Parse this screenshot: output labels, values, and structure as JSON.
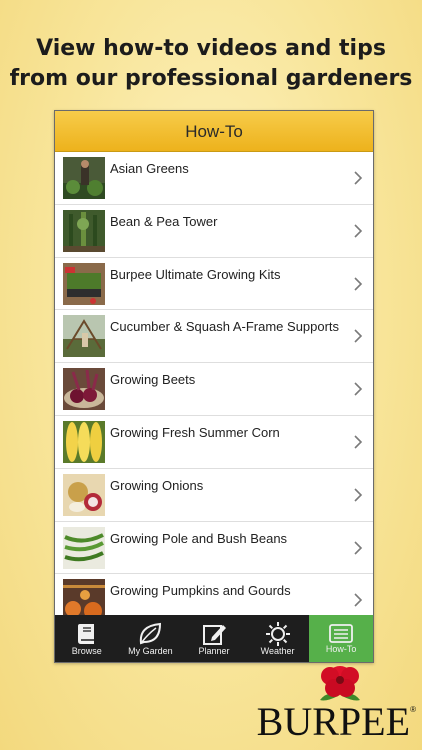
{
  "headline": {
    "line1": "View how-to videos and tips",
    "line2": "from our professional gardeners"
  },
  "navbar": {
    "title": "How-To"
  },
  "items": [
    {
      "label": "Asian Greens",
      "icon": "greens-photo"
    },
    {
      "label": "Bean & Pea Tower",
      "icon": "bean-tower-photo"
    },
    {
      "label": "Burpee Ultimate Growing Kits",
      "icon": "growing-kit-photo"
    },
    {
      "label": "Cucumber & Squash A-Frame Supports",
      "icon": "aframe-photo"
    },
    {
      "label": "Growing Beets",
      "icon": "beets-photo"
    },
    {
      "label": "Growing Fresh Summer Corn",
      "icon": "corn-photo"
    },
    {
      "label": "Growing Onions",
      "icon": "onions-photo"
    },
    {
      "label": "Growing Pole and Bush Beans",
      "icon": "beans-photo"
    },
    {
      "label": "Growing Pumpkins and Gourds",
      "icon": "pumpkins-photo"
    }
  ],
  "tabs": [
    {
      "label": "Browse",
      "icon": "book-icon"
    },
    {
      "label": "My Garden",
      "icon": "leaf-icon"
    },
    {
      "label": "Planner",
      "icon": "pencil-icon"
    },
    {
      "label": "Weather",
      "icon": "sun-icon"
    },
    {
      "label": "How-To",
      "icon": "list-icon",
      "active": true
    }
  ],
  "brand": {
    "name": "BURPEE",
    "flower_color": "#e0112b",
    "accent": "#56b04a"
  },
  "colors": {
    "navbar": "#f0b92a",
    "tab_active": "#56b04a",
    "tabbar": "#1e1e1e"
  }
}
